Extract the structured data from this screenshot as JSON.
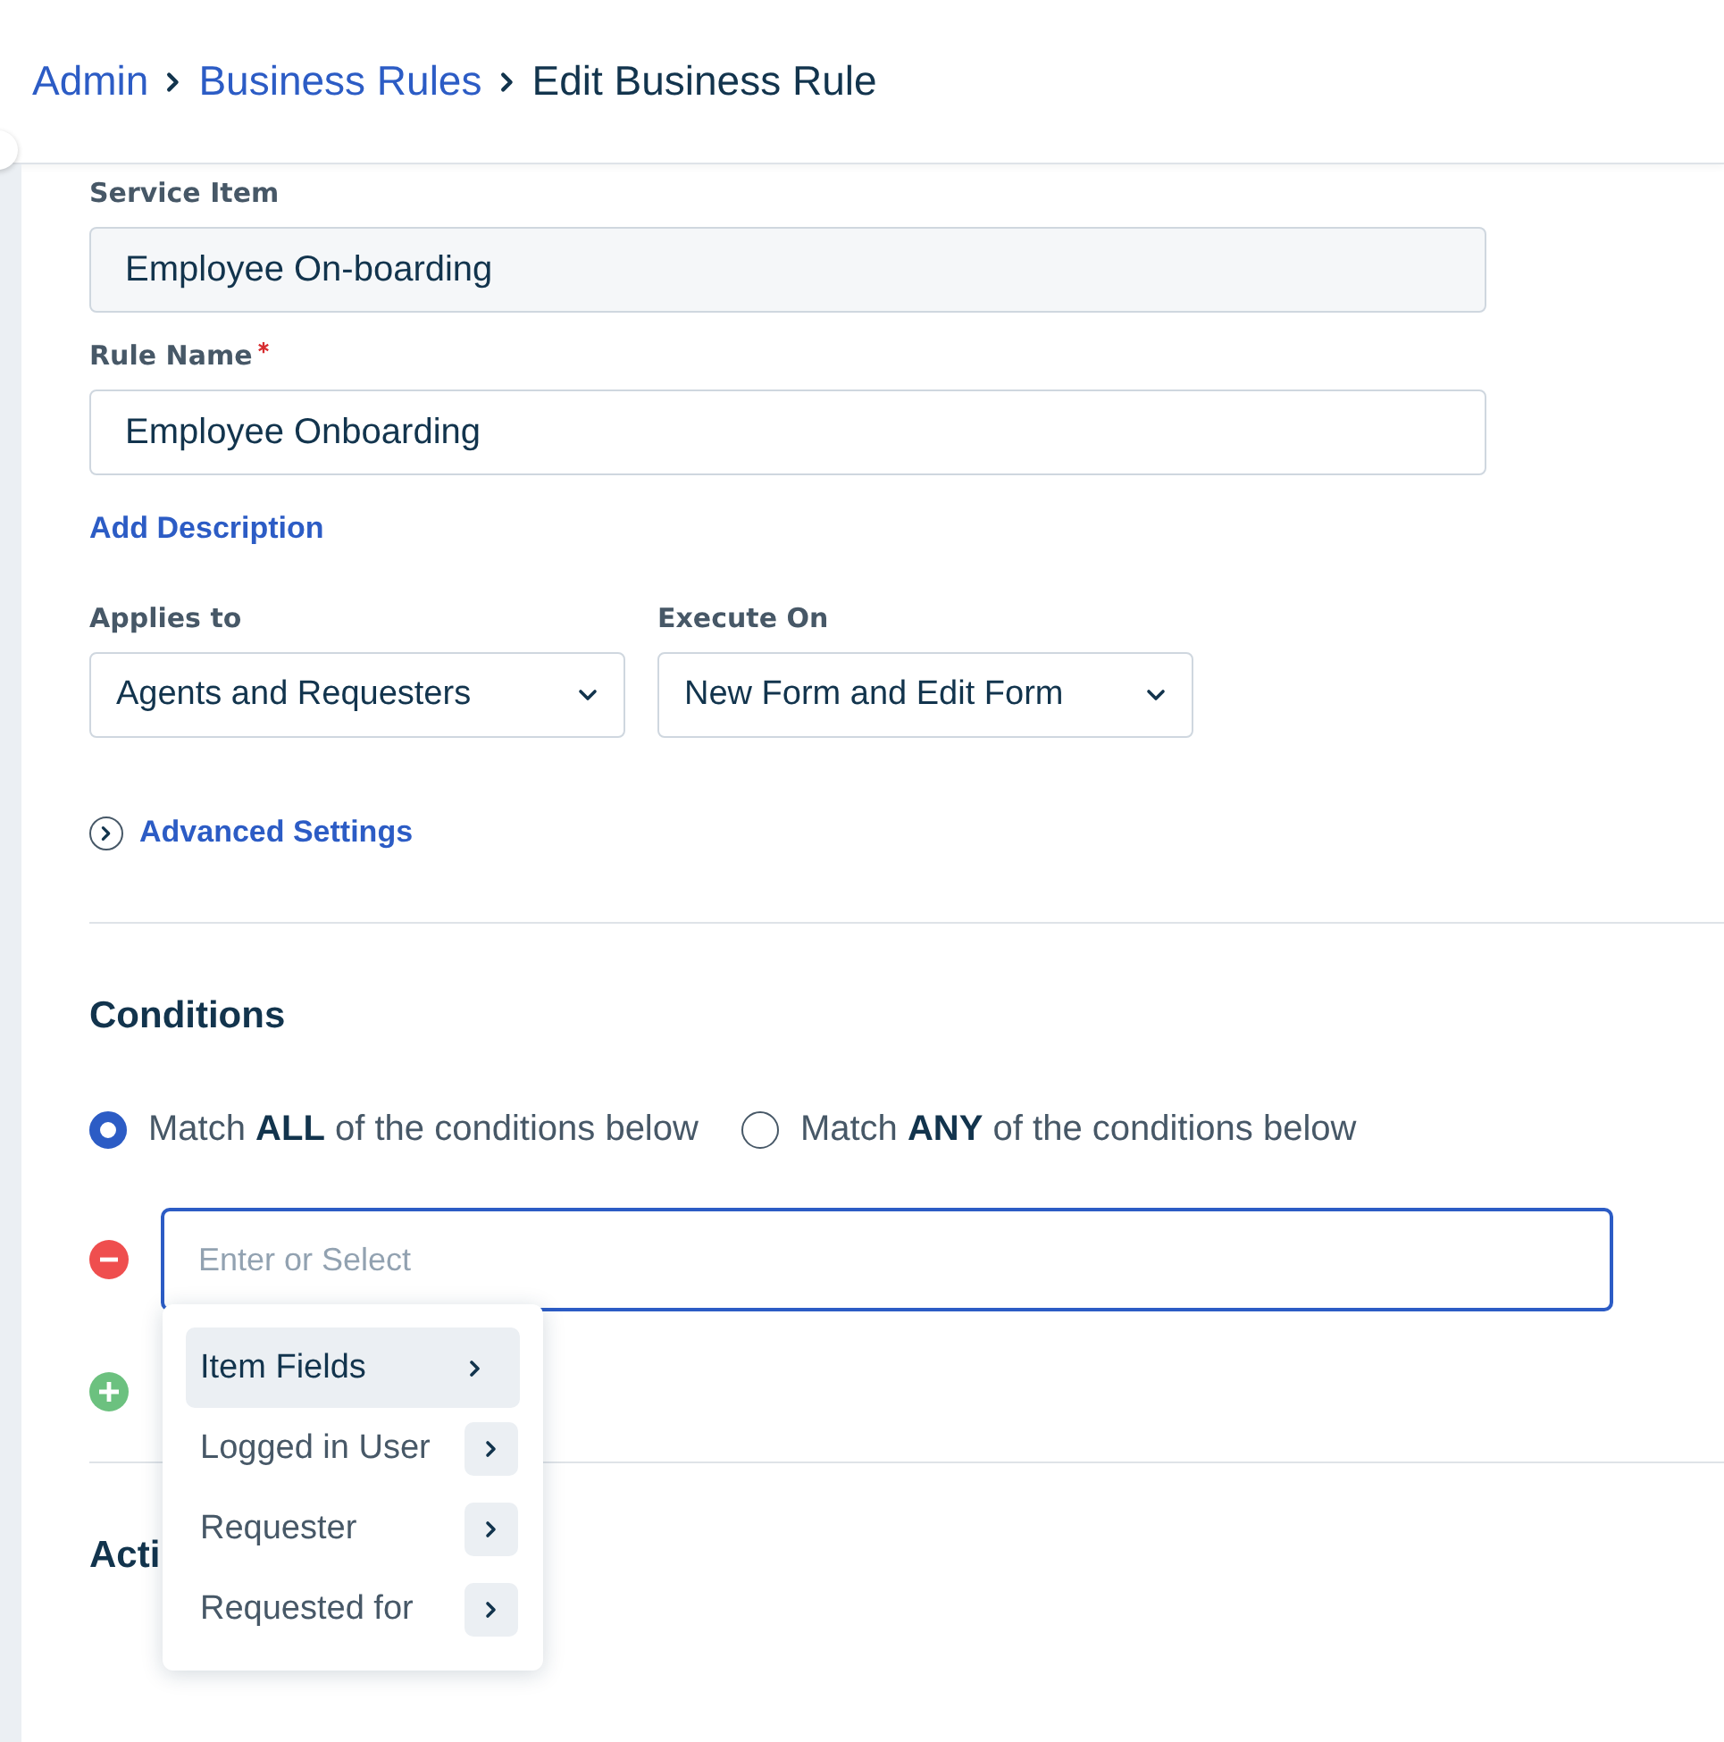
{
  "breadcrumb": [
    {
      "label": "Admin",
      "kind": "link"
    },
    {
      "label": "Business Rules",
      "kind": "link"
    },
    {
      "label": "Edit Business Rule",
      "kind": "current"
    }
  ],
  "form": {
    "service_item": {
      "label": "Service Item",
      "value": "Employee On-boarding"
    },
    "rule_name": {
      "label": "Rule Name",
      "required": true,
      "value": "Employee Onboarding"
    },
    "add_description": "Add Description",
    "selects": [
      {
        "label": "Applies to",
        "value": "Agents and Requesters"
      },
      {
        "label": "Execute On",
        "value": "New Form and Edit Form"
      }
    ],
    "advanced_settings": {
      "label": "Advanced Settings",
      "expanded": false
    }
  },
  "conditions": {
    "title": "Conditions",
    "match_options": [
      {
        "label": "Match **ALL** of the conditions below",
        "selected": true
      },
      {
        "label": "Match **ANY** of the conditions below",
        "selected": false
      }
    ],
    "condition_field": {
      "placeholder": "Enter or Select"
    },
    "menu": [
      {
        "label": "Item Fields",
        "selected": true
      },
      {
        "label": "Logged in User",
        "selected": false
      },
      {
        "label": "Requester",
        "selected": false
      },
      {
        "label": "Requested for",
        "selected": false
      }
    ]
  },
  "actions": {
    "title": "Acti"
  }
}
